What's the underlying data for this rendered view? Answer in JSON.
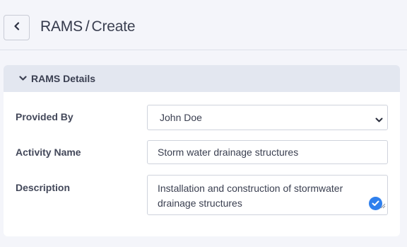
{
  "header": {
    "title_main": "RAMS",
    "title_separator": "/",
    "title_sub": "Create"
  },
  "card": {
    "section_title": "RAMS Details",
    "fields": {
      "provided_by": {
        "label": "Provided By",
        "value": "John Doe"
      },
      "activity_name": {
        "label": "Activity Name",
        "value": "Storm water drainage structures"
      },
      "description": {
        "label": "Description",
        "value": "Installation and construction of stormwater drainage structures"
      }
    }
  },
  "icons": {
    "back": "chevron-left-icon",
    "section_toggle": "chevron-down-icon",
    "select_caret": "chevron-down-icon",
    "valid": "check-circle-icon"
  },
  "colors": {
    "background": "#f4f5fa",
    "card_header": "#e3e7f0",
    "accent": "#2f80ed",
    "text": "#33384a"
  }
}
